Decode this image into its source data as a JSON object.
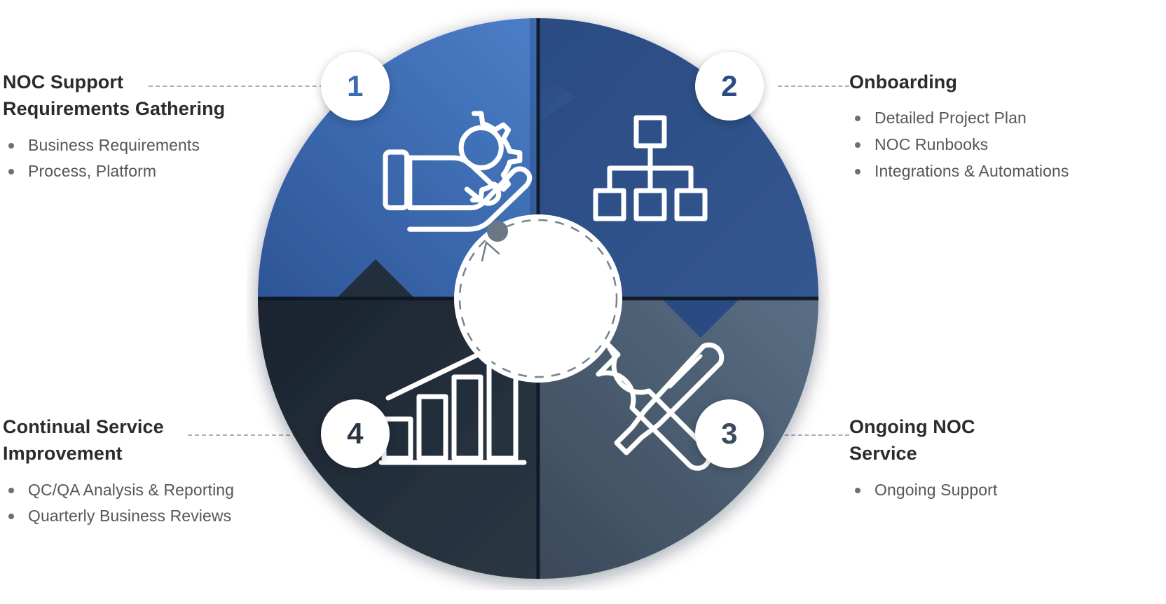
{
  "diagram": {
    "type": "cyclical-4-stage-donut",
    "center": {
      "cycle_arrow": "dashed-circular-arrow",
      "marker_dot": "progress-dot"
    },
    "colors": {
      "stage1": "#4072bd",
      "stage1_dark": "#2d5596",
      "stage2": "#2b4c82",
      "stage2_dark": "#22406f",
      "stage3": "#55687d",
      "stage3_dark": "#3b4a5b",
      "stage4": "#222c38",
      "stage4_dark": "#1a2430",
      "badge_bg": "#ffffff",
      "heading": "#2b2b2b",
      "bullet_text": "#55565a",
      "connector": "#9aa2b4",
      "icon": "#ffffff"
    },
    "stages": [
      {
        "number": "1",
        "title_line1": "NOC Support",
        "title_line2": "Requirements Gathering",
        "icon": "hand-holding-gear-icon",
        "bullets": [
          "Business Requirements",
          "Process, Platform"
        ]
      },
      {
        "number": "2",
        "title_line1": "Onboarding",
        "title_line2": "",
        "icon": "org-chart-hierarchy-icon",
        "bullets": [
          "Detailed Project Plan",
          "NOC Runbooks",
          "Integrations & Automations"
        ]
      },
      {
        "number": "3",
        "title_line1": "Ongoing NOC",
        "title_line2": "Service",
        "icon": "wrench-screwdriver-tools-icon",
        "bullets": [
          "Ongoing Support"
        ]
      },
      {
        "number": "4",
        "title_line1": "Continual Service",
        "title_line2": "Improvement",
        "icon": "growth-bar-chart-arrow-icon",
        "bullets": [
          "QC/QA Analysis & Reporting",
          "Quarterly Business Reviews"
        ]
      }
    ]
  },
  "topleft": {
    "title_line1": "NOC Support",
    "title_line2": "Requirements Gathering",
    "bullet1": "Business Requirements",
    "bullet2": "Process, Platform"
  },
  "topright": {
    "title_line1": "Onboarding",
    "bullet1": "Detailed Project Plan",
    "bullet2": "NOC Runbooks",
    "bullet3": "Integrations & Automations"
  },
  "bottomleft": {
    "title_line1": "Continual Service",
    "title_line2": "Improvement",
    "bullet1": "QC/QA Analysis & Reporting",
    "bullet2": "Quarterly Business Reviews"
  },
  "bottomright": {
    "title_line1": "Ongoing NOC",
    "title_line2": "Service",
    "bullet1": "Ongoing Support"
  },
  "badges": {
    "one": "1",
    "two": "2",
    "three": "3",
    "four": "4"
  }
}
